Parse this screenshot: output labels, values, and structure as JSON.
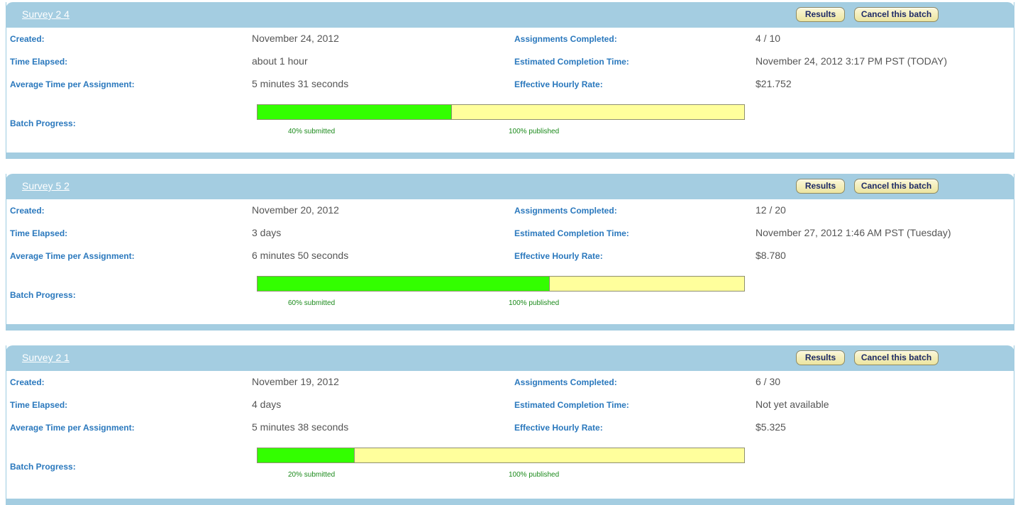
{
  "labels": {
    "created": "Created:",
    "time_elapsed": "Time Elapsed:",
    "avg_time": "Average Time per Assignment:",
    "batch_progress": "Batch Progress:",
    "assignments_completed": "Assignments Completed:",
    "est_completion": "Estimated Completion Time:",
    "hourly_rate": "Effective Hourly Rate:"
  },
  "buttons": {
    "results": "Results",
    "cancel": "Cancel this batch"
  },
  "batches": [
    {
      "title": "Survey 2 4",
      "created": "November 24, 2012",
      "time_elapsed": "about 1 hour",
      "avg_time": "5 minutes 31 seconds",
      "assignments_completed": "4 / 10",
      "est_completion": "November 24, 2012 3:17 PM PST (TODAY)",
      "hourly_rate": "$21.752",
      "submitted_pct": 40,
      "submitted_label": "40% submitted",
      "published_label": "100% published"
    },
    {
      "title": "Survey 5 2",
      "created": "November 20, 2012",
      "time_elapsed": "3 days",
      "avg_time": "6 minutes 50 seconds",
      "assignments_completed": "12 / 20",
      "est_completion": "November 27, 2012 1:46 AM PST (Tuesday)",
      "hourly_rate": "$8.780",
      "submitted_pct": 60,
      "submitted_label": "60% submitted",
      "published_label": "100% published"
    },
    {
      "title": "Survey 2 1",
      "created": "November 19, 2012",
      "time_elapsed": "4 days",
      "avg_time": "5 minutes 38 seconds",
      "assignments_completed": "6 / 30",
      "est_completion": "Not yet available",
      "hourly_rate": "$5.325",
      "submitted_pct": 20,
      "submitted_label": "20% submitted",
      "published_label": "100% published"
    }
  ]
}
